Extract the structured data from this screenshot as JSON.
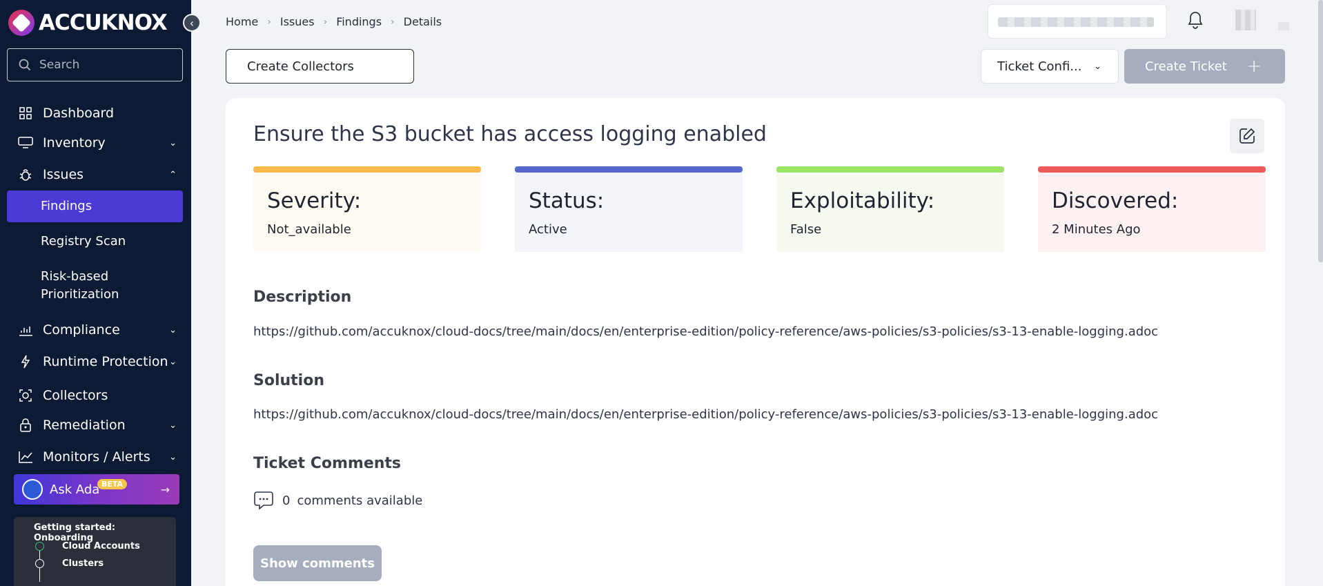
{
  "app": {
    "brand": "ACCUKNOX"
  },
  "sidebar": {
    "search_placeholder": "Search",
    "items": [
      {
        "label": "Dashboard",
        "icon": "dashboard-icon"
      },
      {
        "label": "Inventory",
        "icon": "inventory-icon"
      },
      {
        "label": "Issues",
        "icon": "bug-icon"
      },
      {
        "label": "Compliance",
        "icon": "compliance-icon"
      },
      {
        "label": "Runtime Protection",
        "icon": "bolt-icon"
      },
      {
        "label": "Collectors",
        "icon": "collectors-icon"
      },
      {
        "label": "Remediation",
        "icon": "lock-icon"
      },
      {
        "label": "Monitors / Alerts",
        "icon": "chart-line-icon"
      }
    ],
    "sub_items": [
      "Findings",
      "Registry Scan",
      "Risk-based",
      "Prioritization"
    ],
    "ask_ada": {
      "label": "Ask Ada",
      "badge": "BETA"
    },
    "onboarding": {
      "title": "Getting started: Onboarding",
      "steps": [
        "Cloud Accounts",
        "Clusters"
      ]
    }
  },
  "breadcrumb": [
    "Home",
    "Issues",
    "Findings",
    "Details"
  ],
  "actions": {
    "create_collectors": "Create Collectors",
    "ticket_config": "Ticket Confi...",
    "create_ticket": "Create Ticket"
  },
  "finding": {
    "title": "Ensure the S3 bucket has access logging enabled",
    "stats": [
      {
        "label": "Severity:",
        "value": "Not_available",
        "accent": "#f9b94b",
        "bg": "#fffbf3"
      },
      {
        "label": "Status:",
        "value": "Active",
        "accent": "#5566cc",
        "bg": "#f4f5fb"
      },
      {
        "label": "Exploitability:",
        "value": "False",
        "accent": "#9be564",
        "bg": "#f6faf1"
      },
      {
        "label": "Discovered:",
        "value": "2 Minutes Ago",
        "accent": "#ec5a5a",
        "bg": "#fdf2f1"
      }
    ],
    "description_heading": "Description",
    "description": "https://github.com/accuknox/cloud-docs/tree/main/docs/en/enterprise-edition/policy-reference/aws-policies/s3-policies/s3-13-enable-logging.adoc",
    "solution_heading": "Solution",
    "solution": "https://github.com/accuknox/cloud-docs/tree/main/docs/en/enterprise-edition/policy-reference/aws-policies/s3-policies/s3-13-enable-logging.adoc",
    "comments_heading": "Ticket Comments",
    "comments_count": "0",
    "comments_text": "comments available",
    "show_comments": "Show comments"
  }
}
